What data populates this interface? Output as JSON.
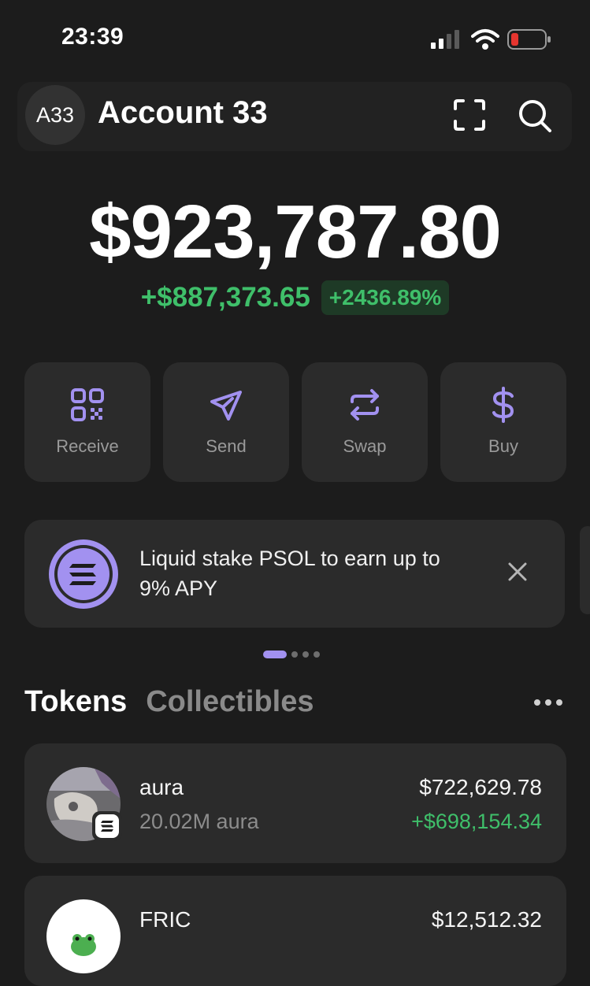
{
  "status_bar": {
    "time": "23:39"
  },
  "header": {
    "avatar_text": "A33",
    "account_name": "Account 33"
  },
  "balance": {
    "total": "$923,787.80",
    "change_amount": "+$887,373.65",
    "change_percent": "+2436.89%"
  },
  "actions": [
    {
      "label": "Receive",
      "icon": "qr-code-icon"
    },
    {
      "label": "Send",
      "icon": "send-icon"
    },
    {
      "label": "Swap",
      "icon": "swap-icon"
    },
    {
      "label": "Buy",
      "icon": "dollar-icon"
    }
  ],
  "banner": {
    "text": "Liquid stake PSOL to earn up to 9% APY",
    "icon": "solana-icon"
  },
  "pagination": {
    "active_index": 0,
    "count": 4
  },
  "tabs": [
    {
      "label": "Tokens",
      "active": true
    },
    {
      "label": "Collectibles",
      "active": false
    }
  ],
  "tokens": [
    {
      "name": "aura",
      "amount": "20.02M aura",
      "value": "$722,629.78",
      "change": "+$698,154.34"
    },
    {
      "name": "FRIC",
      "value": "$12,512.32"
    }
  ],
  "colors": {
    "background": "#1c1c1c",
    "card": "#2b2b2b",
    "accent": "#a291f0",
    "positive": "#3fbf6a"
  }
}
